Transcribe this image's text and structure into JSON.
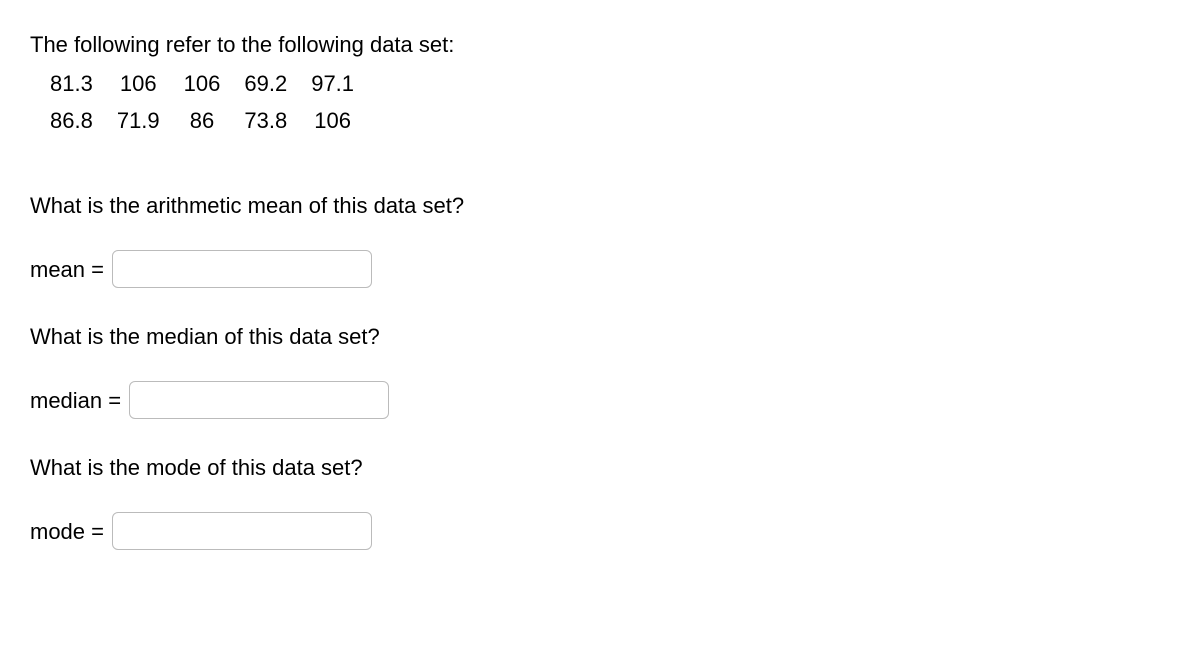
{
  "intro": "The following refer to the following data set:",
  "data_rows": [
    [
      "81.3",
      "106",
      "106",
      "69.2",
      "97.1"
    ],
    [
      "86.8",
      "71.9",
      "86",
      "73.8",
      "106"
    ]
  ],
  "q1": {
    "text": "What is the arithmetic mean of this data set?",
    "label": "mean ="
  },
  "q2": {
    "text": "What is the median of this data set?",
    "label": "median ="
  },
  "q3": {
    "text": "What is the mode of this data set?",
    "label": "mode ="
  }
}
